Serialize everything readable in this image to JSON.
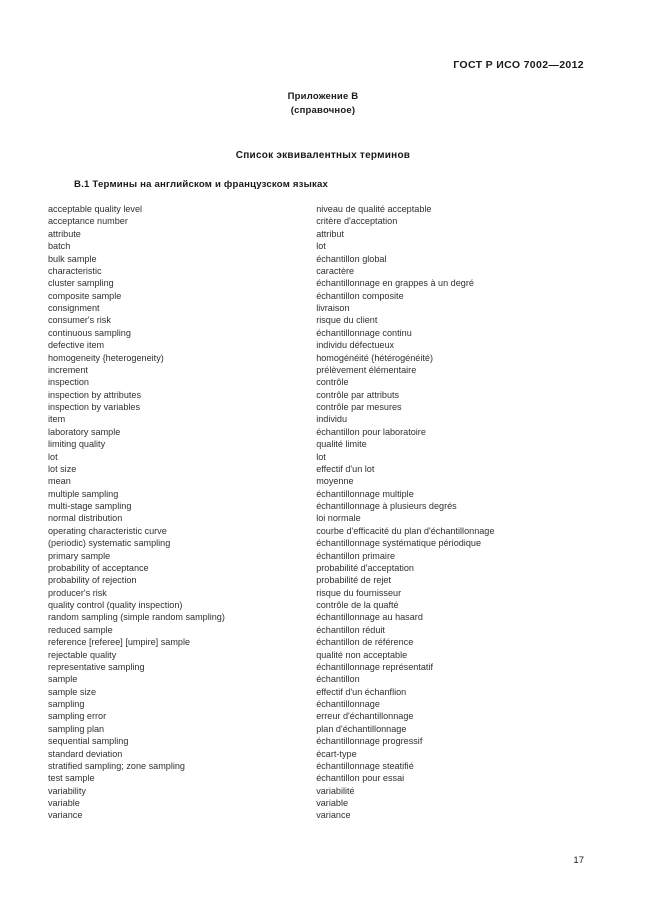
{
  "document": {
    "running_head": "ГОСТ Р ИСО 7002—2012",
    "page_number": "17"
  },
  "annex": {
    "title": "Приложение В",
    "subtitle": "(справочное)"
  },
  "section": {
    "title": "Список эквивалентных терминов"
  },
  "clause": {
    "heading": "В.1 Термины на английском и французском языках"
  },
  "terms": [
    {
      "en": "acceptable quality level",
      "fr": "niveau de qualité acceptable"
    },
    {
      "en": "acceptance number",
      "fr": "critère d'acceptation"
    },
    {
      "en": "attribute",
      "fr": "attribut"
    },
    {
      "en": "batch",
      "fr": "lot"
    },
    {
      "en": "bulk sample",
      "fr": "échantillon global"
    },
    {
      "en": "characteristic",
      "fr": "caractère"
    },
    {
      "en": "cluster sampling",
      "fr": "échantillonnage en grappes à un degré"
    },
    {
      "en": "composite sample",
      "fr": "échantillon composite"
    },
    {
      "en": "consignment",
      "fr": "livraison"
    },
    {
      "en": "consumer's risk",
      "fr": "risque du client"
    },
    {
      "en": "continuous sampling",
      "fr": "échantillonnage continu"
    },
    {
      "en": "defective item",
      "fr": "individu défectueux"
    },
    {
      "en": "homogeneity {heterogeneity)",
      "fr": "homogénéité {hétérogénéité)"
    },
    {
      "en": "increment",
      "fr": "prélèvement élémentaire"
    },
    {
      "en": "inspection",
      "fr": "contrôle"
    },
    {
      "en": "inspection by attributes",
      "fr": "contrôle par attributs"
    },
    {
      "en": "inspection by variables",
      "fr": "contrôle par mesures"
    },
    {
      "en": "item",
      "fr": "individu"
    },
    {
      "en": "laboratory sample",
      "fr": "échantillon pour laboratoire"
    },
    {
      "en": "limiting quality",
      "fr": "qualité limite"
    },
    {
      "en": "lot",
      "fr": "lot"
    },
    {
      "en": "lot size",
      "fr": "effectif d'un lot"
    },
    {
      "en": "mean",
      "fr": "moyenne"
    },
    {
      "en": "multiple sampling",
      "fr": "échantillonnage multiple"
    },
    {
      "en": "multi-stage sampling",
      "fr": "échantillonnage à plusieurs degrés"
    },
    {
      "en": "normal distribution",
      "fr": "loi normale"
    },
    {
      "en": "operating characteristic curve",
      "fr": "courbe d'efficacité du plan d'échantillonnage"
    },
    {
      "en": "(periodic) systematic sampling",
      "fr": "échantillonnage systématique périodique"
    },
    {
      "en": "primary sample",
      "fr": "échantillon primaire"
    },
    {
      "en": "probability of acceptance",
      "fr": "probabilité d'acceptation"
    },
    {
      "en": "probability of rejection",
      "fr": "probabilité de rejet"
    },
    {
      "en": "producer's risk",
      "fr": "risque du fournisseur"
    },
    {
      "en": "quality control (quality inspection)",
      "fr": "contrôle de la quafté"
    },
    {
      "en": "random sampling (simple random sampling)",
      "fr": "échantillonnage au hasard"
    },
    {
      "en": "reduced sample",
      "fr": "échantillon réduit"
    },
    {
      "en": "reference [referee] [umpire] sample",
      "fr": "échantillon de référence"
    },
    {
      "en": "rejectable quality",
      "fr": "qualité non acceptable"
    },
    {
      "en": "representative sampling",
      "fr": "échantillonnage représentatif"
    },
    {
      "en": "sample",
      "fr": "échantillon"
    },
    {
      "en": "sample size",
      "fr": "effectif d'un échanflion"
    },
    {
      "en": "sampling",
      "fr": "échantillonnage"
    },
    {
      "en": "sampling error",
      "fr": "erreur d'échantillonnage"
    },
    {
      "en": "sampling plan",
      "fr": "plan d'échantillonnage"
    },
    {
      "en": "sequential sampling",
      "fr": "échantillonnage progressif"
    },
    {
      "en": "standard deviation",
      "fr": "écart-type"
    },
    {
      "en": "stratified sampling; zone sampling",
      "fr": "échantillonnage steatifié"
    },
    {
      "en": "test sample",
      "fr": "échantillon pour essai"
    },
    {
      "en": "variability",
      "fr": "variabilité"
    },
    {
      "en": "variable",
      "fr": "variable"
    },
    {
      "en": "variance",
      "fr": "variance"
    }
  ]
}
